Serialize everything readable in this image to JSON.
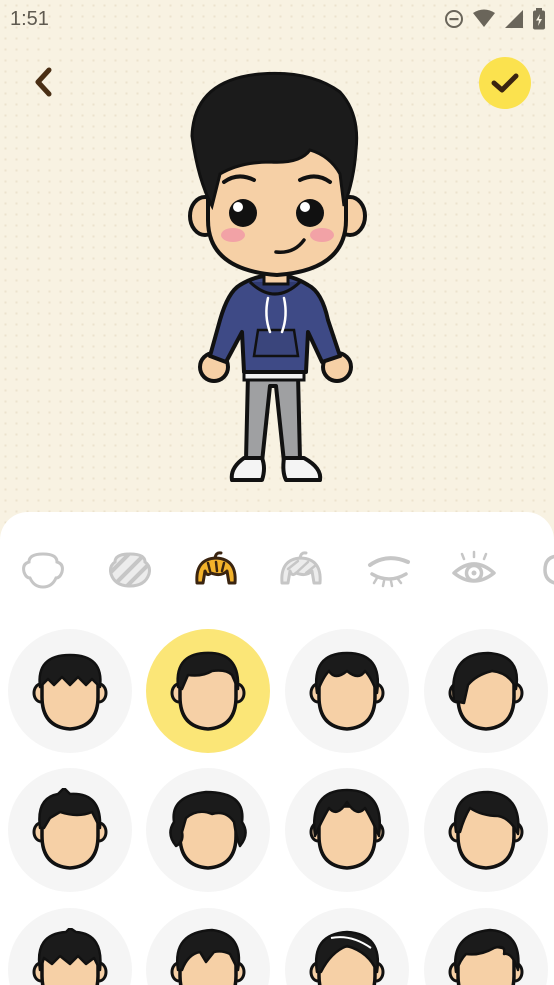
{
  "status_bar": {
    "time": "1:51",
    "battery_state": "charging",
    "icons": [
      "do-not-disturb-icon",
      "wifi-icon",
      "signal-icon",
      "battery-icon"
    ]
  },
  "header": {
    "back_icon": "chevron-left-icon",
    "confirm_icon": "checkmark-icon"
  },
  "colors": {
    "accent": "#fbe24e",
    "selected_option": "#fbe677",
    "canvas_bg": "#f8f2e2",
    "hoodie": "#3e4a86",
    "skin": "#f6d0a6"
  },
  "categories": [
    {
      "id": "face-shape",
      "icon": "face-shape-icon"
    },
    {
      "id": "skin",
      "icon": "skin-tone-icon"
    },
    {
      "id": "hair",
      "icon": "hair-icon",
      "active": true
    },
    {
      "id": "hair-back",
      "icon": "hair-back-icon"
    },
    {
      "id": "eyebrows",
      "icon": "eyebrow-icon"
    },
    {
      "id": "eyes",
      "icon": "eye-icon"
    },
    {
      "id": "ears",
      "icon": "ear-icon"
    }
  ],
  "hair_options": [
    {
      "style": "bowl",
      "selected": false
    },
    {
      "style": "side-swept",
      "selected": true
    },
    {
      "style": "center-part",
      "selected": false
    },
    {
      "style": "long-side-part",
      "selected": false
    },
    {
      "style": "spiky",
      "selected": false
    },
    {
      "style": "wavy-bob",
      "selected": false
    },
    {
      "style": "middle-part-fringe",
      "selected": false
    },
    {
      "style": "side-fringe",
      "selected": false
    },
    {
      "style": "messy",
      "selected": false
    },
    {
      "style": "pompadour",
      "selected": false
    },
    {
      "style": "layered",
      "selected": false
    },
    {
      "style": "quiff",
      "selected": false
    }
  ]
}
